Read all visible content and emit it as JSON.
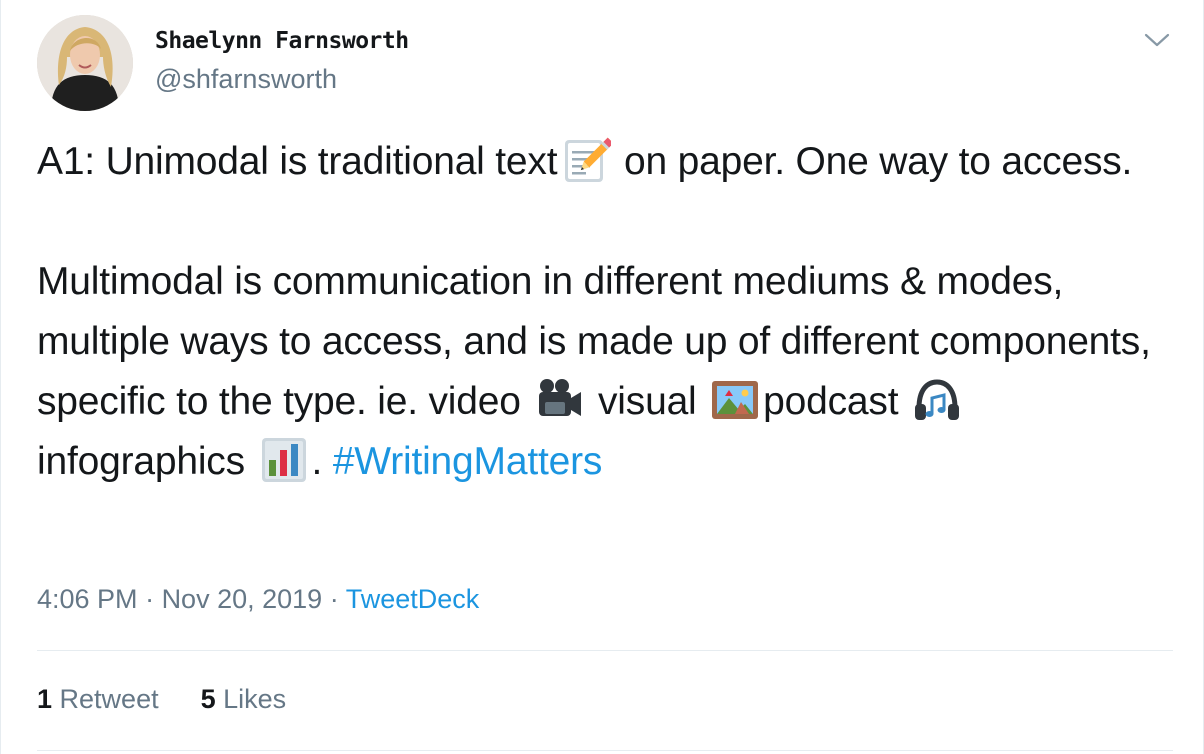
{
  "tweet": {
    "author": {
      "display_name": "Shaelynn Farnsworth",
      "handle": "@shfarnsworth"
    },
    "text": {
      "p1_a": "A1: Unimodal is traditional text",
      "p1_b": " on paper. One way to access.",
      "p2_a": "Multimodal is communication in different mediums & modes, multiple ways to access, and is made up of different components, specific to the type. ie. video ",
      "p2_b": " visual ",
      "p2_c": "podcast ",
      "p2_d": " infographics ",
      "p2_e": ". ",
      "hashtag": "#WritingMatters"
    },
    "emojis": [
      "memo-icon",
      "movie-camera-icon",
      "framed-picture-icon",
      "headphones-icon",
      "bar-chart-icon"
    ],
    "meta": {
      "time": "4:06 PM",
      "separator": " · ",
      "date": "Nov 20, 2019",
      "separator2": " · ",
      "source": "TweetDeck"
    },
    "stats": {
      "retweets_count": "1",
      "retweets_label": " Retweet",
      "likes_count": "5",
      "likes_label": " Likes"
    },
    "colors": {
      "link": "#1b95e0",
      "secondary_text": "#657786",
      "primary_text": "#14171a",
      "divider": "#e6ecf0"
    }
  }
}
